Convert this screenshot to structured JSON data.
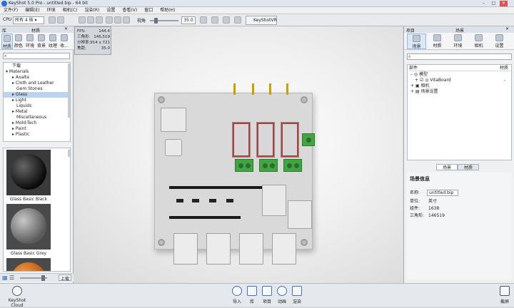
{
  "window": {
    "title": "KeyShot 5.0 Pro - untitled.bip - 64 bit"
  },
  "menu": [
    "文件(F)",
    "编辑(E)",
    "环境",
    "相机(C)",
    "渲染(R)",
    "设置",
    "查看(V)",
    "窗口",
    "帮助(H)"
  ],
  "toolbar": {
    "cpu_label": "CPU",
    "cpu_value": "所有 4 核",
    "fov_label": "视角",
    "fov_value": "35.0",
    "vr_label": "KeyShotVR"
  },
  "library": {
    "header": "库",
    "header_right": "材质",
    "tabs": [
      "材质",
      "颜色",
      "环境",
      "背景",
      "纹理",
      "收..."
    ],
    "tree": [
      "下载",
      "Materials",
      "Axalta",
      "Cloth and Leather",
      "Gem Stones",
      "Glass",
      "Light",
      "Liquids",
      "Metal",
      "Miscellaneous",
      "Mold-Tech",
      "Paint",
      "Plastic"
    ],
    "selected": "Glass",
    "thumbs": [
      "Glass Basic Black",
      "Glass Basic Grey"
    ],
    "bottom_button": "上载"
  },
  "hud": {
    "fps_label": "FPS:",
    "fps": "144.4",
    "tri_label": "三角形:",
    "tri": "146,519",
    "res_label": "分辨率:",
    "res": "914 x 721",
    "focal_label": "焦距:",
    "focal": "35.0"
  },
  "project": {
    "header": "项目",
    "header_right": "场景",
    "tabs": [
      "场景",
      "材质",
      "环境",
      "相机",
      "设置"
    ],
    "columns": [
      "部件",
      "材质"
    ],
    "tree": [
      "模型",
      "VitaBoard",
      "相机",
      "场景设置"
    ],
    "vitaboard_mat": "-",
    "subtabs": [
      "场景",
      "材质"
    ],
    "info_title": "场景信息",
    "name_label": "名称:",
    "name_value": "untitled.bip",
    "unit_label": "单位:",
    "unit_value": "英寸",
    "parts_label": "组件:",
    "parts_value": "1638",
    "tri_label": "三角形:",
    "tri_value": "146519"
  },
  "bottom": {
    "cloud": "KeyShot Cloud",
    "buttons": [
      "导入",
      "库",
      "项目",
      "动画",
      "渲染"
    ],
    "screenshot": "截屏"
  },
  "colors": {
    "accent": "#3b75c4",
    "selection": "#bcd2ee"
  }
}
